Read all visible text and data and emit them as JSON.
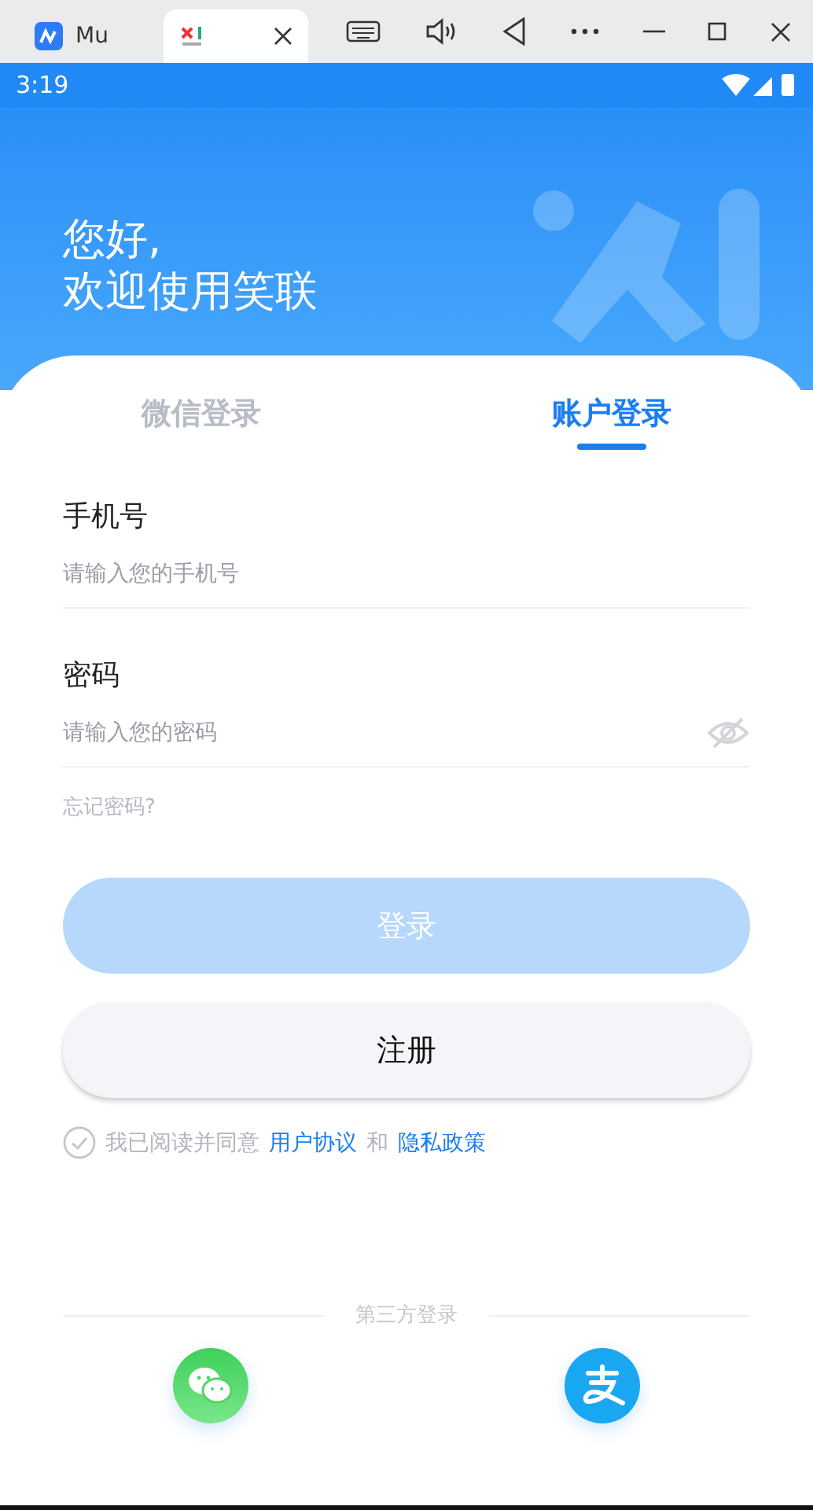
{
  "browser_tabs": [
    {
      "label": "Mu",
      "selected": false
    },
    {
      "selected": true
    }
  ],
  "status_bar": {
    "time": "3:19"
  },
  "greeting": [
    "您好,",
    "欢迎使用笑联"
  ],
  "login_tabs": [
    {
      "label": "微信登录",
      "selected": false
    },
    {
      "label": "账户登录",
      "selected": true
    }
  ],
  "fields": [
    {
      "kind": "text",
      "label": "手机号",
      "placeholder": "请输入您的手机号"
    },
    {
      "kind": "password",
      "label": "密码",
      "placeholder": "请输入您的密码"
    }
  ],
  "forgot_password": "忘记密码?",
  "login_button": {
    "label": "登录",
    "disabled": true
  },
  "register_button": {
    "label": "注册"
  },
  "agreement": {
    "checked": false,
    "text": "我已阅读并同意",
    "user_agreement": "用户协议",
    "conjunction": "和",
    "privacy_policy": "隐私政策"
  },
  "third_party": {
    "label": "第三方登录",
    "providers": [
      {
        "kind": "wechat"
      },
      {
        "kind": "alipay"
      }
    ]
  }
}
